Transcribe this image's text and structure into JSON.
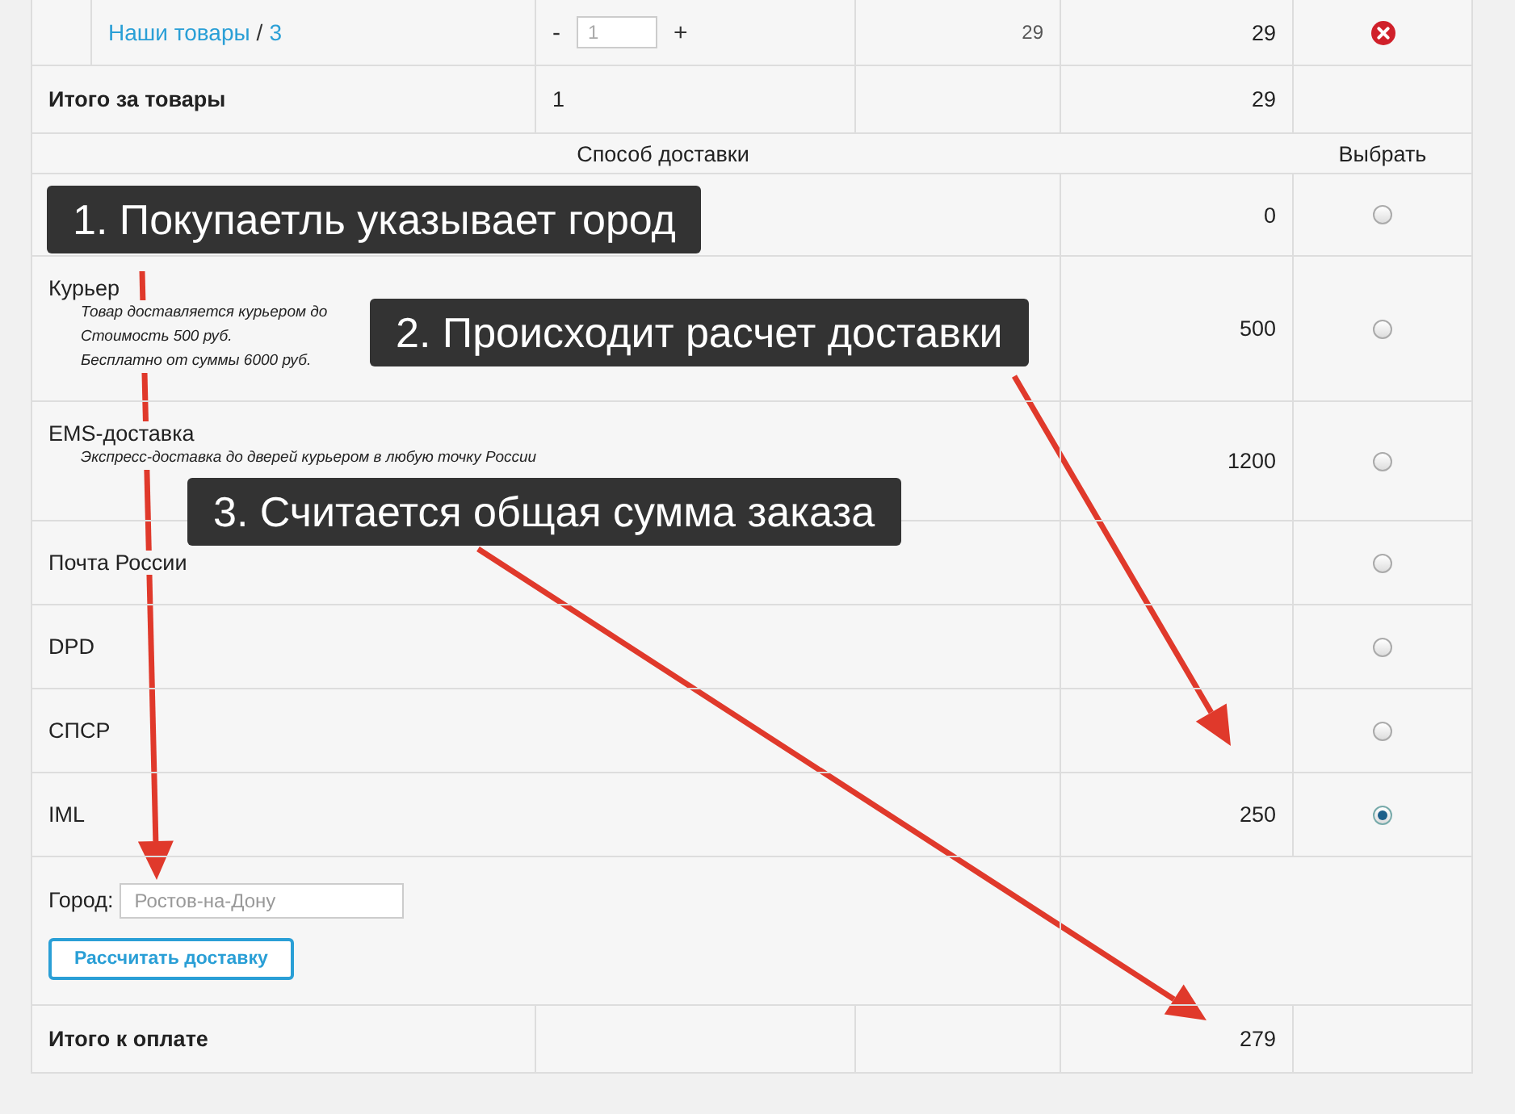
{
  "product_row": {
    "link": "Наши товары",
    "separator": "/",
    "count": "3",
    "quantity": {
      "minus": "-",
      "value": "1",
      "plus": "+"
    },
    "price": "29",
    "sum": "29"
  },
  "subtotal": {
    "label": "Итого за товары",
    "quantity": "1",
    "sum": "29"
  },
  "delivery_header": {
    "title": "Способ доставки",
    "choose": "Выбрать"
  },
  "delivery_methods": [
    {
      "price": "0",
      "selected": false
    },
    {
      "name": "Курьер",
      "description": [
        "Товар доставляется курьером до",
        "Стоимость 500 руб.",
        "Бесплатно от суммы 6000 руб."
      ],
      "price": "500",
      "selected": false
    },
    {
      "name": "EMS-доставка",
      "description": [
        "Экспресс-доставка до дверей курьером в любую точку России"
      ],
      "price": "1200",
      "selected": false
    },
    {
      "name": "Почта России",
      "selected": false
    },
    {
      "name": "DPD",
      "selected": false
    },
    {
      "name": "СПСР",
      "selected": false
    },
    {
      "name": "IML",
      "price": "250",
      "selected": true
    }
  ],
  "city": {
    "label": "Город:",
    "placeholder": "Ростов-на-Дону"
  },
  "calculate_button": "Рассчитать доставку",
  "total": {
    "label": "Итого к оплате",
    "sum": "279"
  },
  "callouts": [
    {
      "text": "1. Покупаетль указывает город"
    },
    {
      "text": "2. Происходит расчет доставки"
    },
    {
      "text": "3. Считается общая сумма заказа"
    }
  ]
}
